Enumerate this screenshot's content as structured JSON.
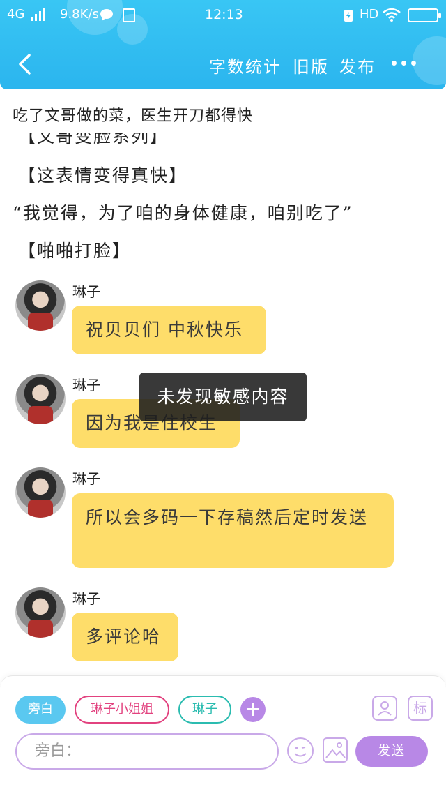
{
  "status_bar": {
    "network": "4G",
    "speed": "9.8K/s",
    "time": "12:13",
    "hd": "HD"
  },
  "nav": {
    "word_count": "字数统计",
    "old_version": "旧版",
    "publish": "发布"
  },
  "story": {
    "title": "吃了文哥做的菜，医生开刀都得快",
    "narration": [
      "【文哥变脸系列】",
      "【这表情变得真快】",
      "“我觉得，为了咱的身体健康，咱别吃了”",
      "【啪啪打脸】"
    ]
  },
  "messages": [
    {
      "sender": "琳子",
      "text": "祝贝贝们 中秋快乐"
    },
    {
      "sender": "琳子",
      "text": "因为我是住校生"
    },
    {
      "sender": "琳子",
      "text": "所以会多码一下存稿然后定时发送"
    },
    {
      "sender": "琳子",
      "text": "多评论哈"
    }
  ],
  "toast": "未发现敏感内容",
  "composer": {
    "roles": [
      "旁白",
      "琳子小姐姐",
      "琳子"
    ],
    "mark_label": "标",
    "placeholder": "旁白：",
    "send_label": "发送"
  },
  "colors": {
    "header": "#2bb5ee",
    "bubble": "#fedd6a",
    "accent_purple": "#b888e6",
    "role_pink": "#e2427f",
    "role_teal": "#2bbcb0"
  }
}
